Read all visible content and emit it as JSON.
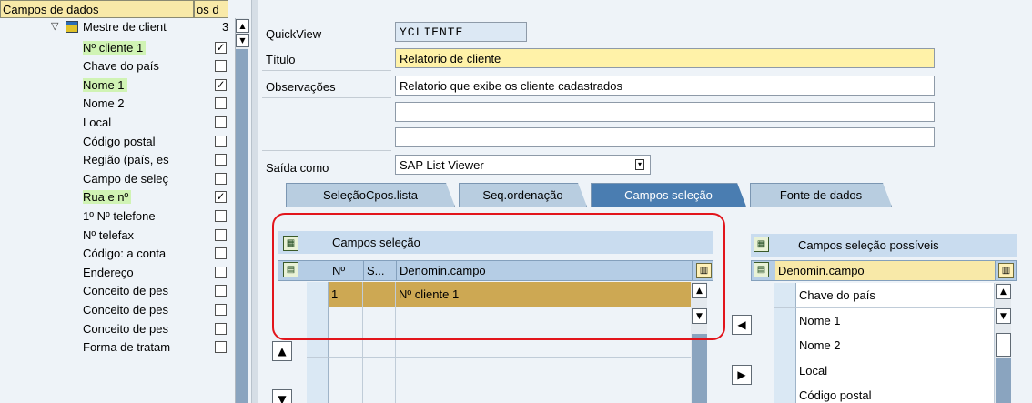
{
  "tree": {
    "header": {
      "col1": "Campos de dados",
      "col2": "os d"
    },
    "root": {
      "label": "Mestre de client",
      "count": "3"
    },
    "items": [
      {
        "label": "Nº cliente 1",
        "checked": true,
        "highlight": true
      },
      {
        "label": "Chave do país",
        "checked": false,
        "highlight": false
      },
      {
        "label": "Nome 1",
        "checked": true,
        "highlight": true
      },
      {
        "label": "Nome 2",
        "checked": false,
        "highlight": false
      },
      {
        "label": "Local",
        "checked": false,
        "highlight": false
      },
      {
        "label": "Código postal",
        "checked": false,
        "highlight": false
      },
      {
        "label": "Região (país, es",
        "checked": false,
        "highlight": false
      },
      {
        "label": "Campo de seleç",
        "checked": false,
        "highlight": false
      },
      {
        "label": "Rua e nº",
        "checked": true,
        "highlight": true
      },
      {
        "label": "1º Nº telefone",
        "checked": false,
        "highlight": false
      },
      {
        "label": "Nº telefax",
        "checked": false,
        "highlight": false
      },
      {
        "label": "Código: a conta",
        "checked": false,
        "highlight": false
      },
      {
        "label": "Endereço",
        "checked": false,
        "highlight": false
      },
      {
        "label": "Conceito de pes",
        "checked": false,
        "highlight": false
      },
      {
        "label": "Conceito de pes",
        "checked": false,
        "highlight": false
      },
      {
        "label": "Conceito de pes",
        "checked": false,
        "highlight": false
      },
      {
        "label": "Forma de tratam",
        "checked": false,
        "highlight": false
      }
    ]
  },
  "form": {
    "quickview_label": "QuickView",
    "quickview_value": "YCLIENTE",
    "titulo_label": "Título",
    "titulo_value": "Relatorio de cliente",
    "obs_label": "Observações",
    "obs_value": "Relatorio que exibe os cliente cadastrados",
    "extra1_value": "",
    "extra2_value": "",
    "saida_label": "Saída como",
    "saida_value": "SAP List Viewer"
  },
  "tabs": [
    {
      "label": "SeleçãoCpos.lista",
      "active": false
    },
    {
      "label": "Seq.ordenação",
      "active": false
    },
    {
      "label": "Campos seleção",
      "active": true
    },
    {
      "label": "Fonte de dados",
      "active": false
    }
  ],
  "left_table": {
    "title": "Campos seleção",
    "headers": {
      "no": "Nº",
      "s": "S...",
      "name": "Denomin.campo"
    },
    "rows": [
      {
        "no": "1",
        "s": "",
        "name": "Nº cliente 1"
      }
    ]
  },
  "right_table": {
    "title": "Campos seleção possíveis",
    "header": "Denomin.campo",
    "rows": [
      "Chave do país",
      "Nome 1",
      "Nome 2",
      "Local",
      "Código postal"
    ]
  },
  "colors": {
    "highlight_row": "#cda853",
    "active_tab": "#4a7db1",
    "annotation": "#e2141b"
  },
  "icons": {
    "tree_expand": "triangle-down-icon",
    "table_node": "table-icon",
    "move_left": "arrow-left-icon",
    "move_right": "arrow-right-icon",
    "move_up": "arrow-up-icon",
    "move_down": "arrow-down-icon",
    "column_settings": "column-config-icon",
    "select_all": "select-all-icon",
    "deselect_all": "deselect-all-icon",
    "dropdown": "dropdown-icon"
  }
}
